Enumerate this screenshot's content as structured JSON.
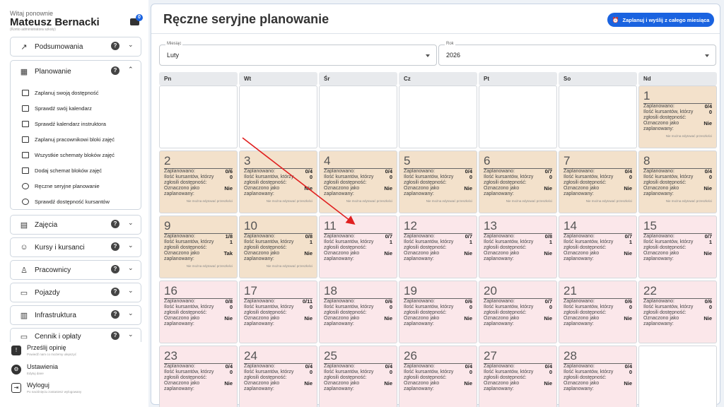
{
  "sidebar": {
    "welcome": "Witaj ponownie",
    "user_name": "Mateusz Bernacki",
    "user_sub": "(Konto administratora szkoły)",
    "chat_badge": "0",
    "sections": [
      {
        "label": "Podsumowania",
        "icon": "trend-icon"
      },
      {
        "label": "Planowanie",
        "icon": "calendar-icon"
      },
      {
        "label": "Zajęcia",
        "icon": "clipboard-icon"
      },
      {
        "label": "Kursy i kursanci",
        "icon": "face-icon"
      },
      {
        "label": "Pracownicy",
        "icon": "person-icon"
      },
      {
        "label": "Pojazdy",
        "icon": "car-icon"
      },
      {
        "label": "Infrastruktura",
        "icon": "building-icon"
      },
      {
        "label": "Cennik i opłaty",
        "icon": "card-icon"
      }
    ],
    "planning_items": [
      "Zaplanuj swoją dostępność",
      "Sprawdź swój kalendarz",
      "Sprawdź kalendarz instruktora",
      "Zaplanuj pracownikowi bloki zajęć",
      "Wszystkie schematy bloków zajęć",
      "Dodaj schemat bloków zajęć",
      "Ręczne seryjne planowanie",
      "Sprawdź dostępność kursantów"
    ],
    "bottom": [
      {
        "title": "Prześlij opinię",
        "sub": "Powiedź nam co możemy ulepszyć"
      },
      {
        "title": "Ustawienia",
        "sub": "Edytuj dane"
      },
      {
        "title": "Wyloguj",
        "sub": "Po naciśnięciu zostaniesz wylogowany"
      }
    ]
  },
  "main": {
    "title": "Ręczne seryjne planowanie",
    "plan_button": "Zaplanuj i wyślij z całego miesiąca",
    "month_label": "Miesiąc",
    "month_value": "Luty",
    "year_label": "Rok",
    "year_value": "2026",
    "weekdays": [
      "Pn",
      "Wt",
      "Śr",
      "Cz",
      "Pt",
      "So",
      "Nd"
    ],
    "labels": {
      "planned": "Zaplanowano:",
      "count": "Ilość kursantów, którzy zgłosili dostępność:",
      "marked": "Oznaczono jako zaplanowany:",
      "past_note": "Nie można edytować przeszłości"
    },
    "days": [
      {
        "day": "1",
        "planned": "0/4",
        "count": "0",
        "marked": "Nie",
        "past": true
      },
      {
        "day": "2",
        "planned": "0/6",
        "count": "0",
        "marked": "Nie",
        "past": true
      },
      {
        "day": "3",
        "planned": "0/4",
        "count": "0",
        "marked": "Nie",
        "past": true
      },
      {
        "day": "4",
        "planned": "0/4",
        "count": "0",
        "marked": "Nie",
        "past": true
      },
      {
        "day": "5",
        "planned": "0/4",
        "count": "0",
        "marked": "Nie",
        "past": true
      },
      {
        "day": "6",
        "planned": "0/7",
        "count": "0",
        "marked": "Nie",
        "past": true
      },
      {
        "day": "7",
        "planned": "0/4",
        "count": "0",
        "marked": "Nie",
        "past": true
      },
      {
        "day": "8",
        "planned": "0/4",
        "count": "0",
        "marked": "Nie",
        "past": true
      },
      {
        "day": "9",
        "planned": "1/8",
        "count": "1",
        "marked": "Tak",
        "past": true
      },
      {
        "day": "10",
        "planned": "0/8",
        "count": "1",
        "marked": "Nie",
        "past": true
      },
      {
        "day": "11",
        "planned": "0/7",
        "count": "1",
        "marked": "Nie",
        "past": false
      },
      {
        "day": "12",
        "planned": "0/7",
        "count": "1",
        "marked": "Nie",
        "past": false
      },
      {
        "day": "13",
        "planned": "0/8",
        "count": "1",
        "marked": "Nie",
        "past": false
      },
      {
        "day": "14",
        "planned": "0/7",
        "count": "1",
        "marked": "Nie",
        "past": false
      },
      {
        "day": "15",
        "planned": "0/7",
        "count": "1",
        "marked": "Nie",
        "past": false
      },
      {
        "day": "16",
        "planned": "0/8",
        "count": "0",
        "marked": "Nie",
        "past": false
      },
      {
        "day": "17",
        "planned": "0/11",
        "count": "0",
        "marked": "Nie",
        "past": false
      },
      {
        "day": "18",
        "planned": "0/6",
        "count": "0",
        "marked": "Nie",
        "past": false
      },
      {
        "day": "19",
        "planned": "0/6",
        "count": "0",
        "marked": "Nie",
        "past": false
      },
      {
        "day": "20",
        "planned": "0/7",
        "count": "0",
        "marked": "Nie",
        "past": false
      },
      {
        "day": "21",
        "planned": "0/6",
        "count": "0",
        "marked": "Nie",
        "past": false
      },
      {
        "day": "22",
        "planned": "0/6",
        "count": "0",
        "marked": "Nie",
        "past": false
      },
      {
        "day": "23",
        "planned": "0/4",
        "count": "0",
        "marked": "Nie",
        "past": false
      },
      {
        "day": "24",
        "planned": "0/4",
        "count": "0",
        "marked": "Nie",
        "past": false
      },
      {
        "day": "25",
        "planned": "0/4",
        "count": "0",
        "marked": "Nie",
        "past": false
      },
      {
        "day": "26",
        "planned": "0/4",
        "count": "0",
        "marked": "Nie",
        "past": false
      },
      {
        "day": "27",
        "planned": "0/4",
        "count": "0",
        "marked": "Nie",
        "past": false
      },
      {
        "day": "28",
        "planned": "0/4",
        "count": "0",
        "marked": "Nie",
        "past": false
      }
    ]
  },
  "colors": {
    "accent": "#1a63e0",
    "past_day": "#f3e1cb",
    "future_day": "#fbe7ea",
    "arrow": "#e02020"
  }
}
